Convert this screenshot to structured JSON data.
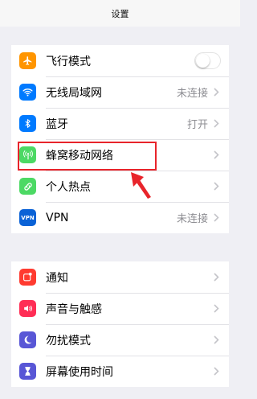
{
  "header": {
    "title": "设置"
  },
  "colors": {
    "airplane": "#ff9500",
    "wifi": "#007aff",
    "bluetooth": "#007aff",
    "cellular": "#4cd964",
    "hotspot": "#4cd964",
    "vpn": "#0a62d6",
    "notifications": "#ff3b30",
    "sounds": "#ff2d55",
    "dnd": "#5856d6",
    "screentime": "#5856d6",
    "highlight": "#e8242b"
  },
  "settings": {
    "group1": [
      {
        "icon": "airplane-icon",
        "label": "飞行模式",
        "toggle": false
      },
      {
        "icon": "wifi-icon",
        "label": "无线局域网",
        "value": "未连接"
      },
      {
        "icon": "bluetooth-icon",
        "label": "蓝牙",
        "value": "打开"
      },
      {
        "icon": "cellular-icon",
        "label": "蜂窝移动网络",
        "value": ""
      },
      {
        "icon": "hotspot-icon",
        "label": "个人热点",
        "value": ""
      },
      {
        "icon": "vpn-icon",
        "label": "VPN",
        "icon_text": "VPN",
        "value": "未连接"
      }
    ],
    "group2": [
      {
        "icon": "notification-icon",
        "label": "通知"
      },
      {
        "icon": "sound-icon",
        "label": "声音与触感"
      },
      {
        "icon": "moon-icon",
        "label": "勿扰模式"
      },
      {
        "icon": "hourglass-icon",
        "label": "屏幕使用时间"
      }
    ]
  }
}
